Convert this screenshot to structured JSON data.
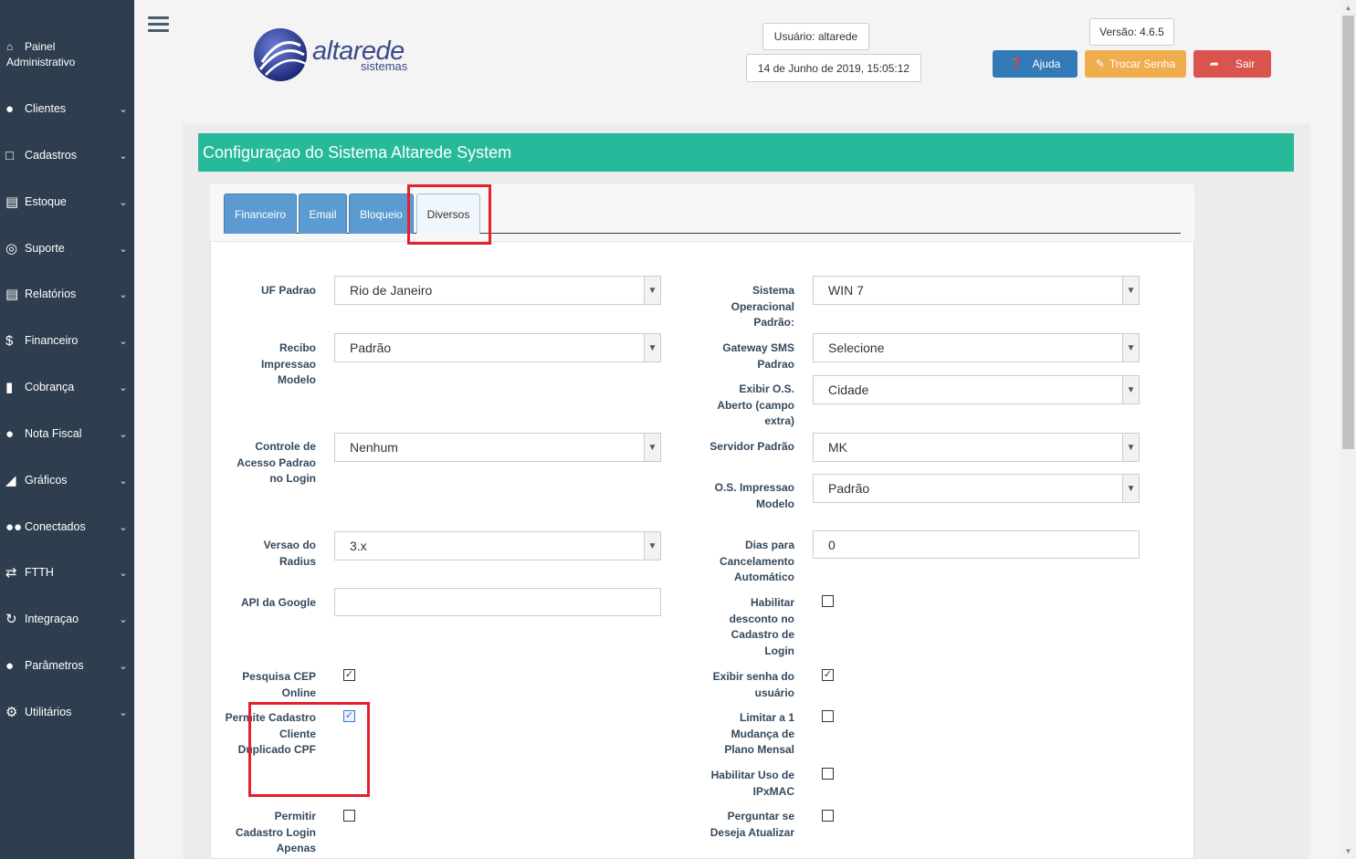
{
  "sidebar": {
    "brand_line1": "Painel",
    "brand_line2": "Administrativo",
    "items": [
      {
        "label": "Clientes"
      },
      {
        "label": "Cadastros"
      },
      {
        "label": "Estoque"
      },
      {
        "label": "Suporte"
      },
      {
        "label": "Relatórios"
      },
      {
        "label": "Financeiro"
      },
      {
        "label": "Cobrança"
      },
      {
        "label": "Nota Fiscal"
      },
      {
        "label": "Gráficos"
      },
      {
        "label": "Conectados"
      },
      {
        "label": "FTTH"
      },
      {
        "label": "Integraçao"
      },
      {
        "label": "Parâmetros"
      },
      {
        "label": "Utilitários"
      }
    ]
  },
  "header": {
    "logo_text": "altarede",
    "logo_sub": "sistemas",
    "user": "Usuário: altarede",
    "datetime": "14 de Junho de 2019, 15:05:12",
    "version": "Versão: 4.6.5",
    "help_label": "Ajuda",
    "change_password_label": "Trocar Senha",
    "logout_label": "Sair"
  },
  "panel": {
    "title": "Configuraçao do Sistema Altarede System",
    "tabs": [
      {
        "label": "Financeiro"
      },
      {
        "label": "Email"
      },
      {
        "label": "Bloqueio"
      },
      {
        "label": "Diversos"
      }
    ]
  },
  "form": {
    "uf_padrao": {
      "label": "UF Padrao",
      "value": "Rio de Janeiro"
    },
    "recibo": {
      "label": "Recibo Impressao Modelo",
      "value": "Padrão"
    },
    "controle_acesso": {
      "label": "Controle de Acesso Padrao no Login",
      "value": "Nenhum"
    },
    "versao_radius": {
      "label": "Versao do Radius",
      "value": "3.x"
    },
    "api_google": {
      "label": "API da Google",
      "value": ""
    },
    "pesquisa_cep": {
      "label": "Pesquisa CEP Online",
      "checked": true
    },
    "permite_cpf": {
      "label": "Permite Cadastro Cliente Duplicado CPF",
      "checked": true
    },
    "permitir_login": {
      "label": "Permitir Cadastro Login Apenas",
      "checked": false
    },
    "sistema_op": {
      "label": "Sistema Operacional Padrão:",
      "value": "WIN 7"
    },
    "gateway_sms": {
      "label": "Gateway SMS Padrao",
      "value": "Selecione"
    },
    "exibir_os": {
      "label": "Exibir O.S. Aberto (campo extra)",
      "value": "Cidade"
    },
    "servidor": {
      "label": "Servidor Padrão",
      "value": "MK"
    },
    "os_impressao": {
      "label": "O.S. Impressao Modelo",
      "value": "Padrão"
    },
    "dias_cancel": {
      "label": "Dias para Cancelamento Automático",
      "value": "0"
    },
    "habilitar_desconto": {
      "label": "Habilitar desconto no Cadastro de Login",
      "checked": false
    },
    "exibir_senha": {
      "label": "Exibir senha do usuário",
      "checked": true
    },
    "limitar_mudanca": {
      "label": "Limitar a 1 Mudança de Plano Mensal",
      "checked": false
    },
    "habilitar_ipxmac": {
      "label": "Habilitar Uso de IPxMAC",
      "checked": false
    },
    "perguntar": {
      "label": "Perguntar se Deseja Atualizar",
      "checked": false
    }
  },
  "colors": {
    "sidebar": "#2e3e4e",
    "header_bar": "#26b99a",
    "help": "#337ab7",
    "warning": "#f0ad4e",
    "danger": "#d9534f",
    "highlight": "#e5202a"
  }
}
